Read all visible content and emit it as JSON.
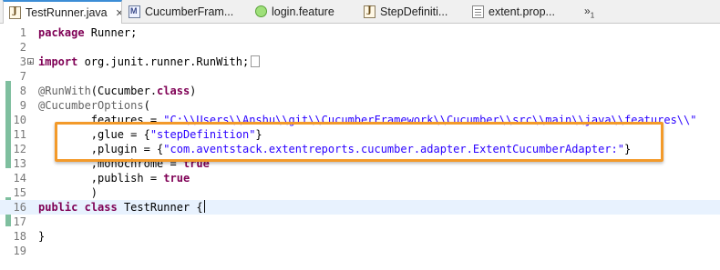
{
  "tabs": [
    {
      "label": "TestRunner.java",
      "icon": "java-file-icon",
      "active": true,
      "close": "✕"
    },
    {
      "label": "CucumberFram...",
      "icon": "java-class-icon"
    },
    {
      "label": "login.feature",
      "icon": "cucumber-feature-icon"
    },
    {
      "label": "StepDefiniti...",
      "icon": "java-file-icon"
    },
    {
      "label": "extent.prop...",
      "icon": "properties-file-icon"
    }
  ],
  "overflow": {
    "symbol": "»",
    "count": "1"
  },
  "lines": [
    {
      "num": "1",
      "parts": [
        {
          "kw": "package"
        },
        {
          "t": " Runner;"
        }
      ]
    },
    {
      "num": "2",
      "parts": []
    },
    {
      "num": "3",
      "fold": "+",
      "parts": [
        {
          "kw": "import"
        },
        {
          "t": " org.junit.runner.RunWith;"
        }
      ]
    },
    {
      "num": "7",
      "parts": []
    },
    {
      "num": "8",
      "parts": [
        {
          "ann": "@RunWith"
        },
        {
          "t": "(Cucumber."
        },
        {
          "kw": "class"
        },
        {
          "t": ")"
        }
      ]
    },
    {
      "num": "9",
      "parts": [
        {
          "ann": "@CucumberOptions"
        },
        {
          "t": "("
        }
      ]
    },
    {
      "num": "10",
      "parts": [
        {
          "t": "        features = "
        },
        {
          "str": "\"C:\\\\Users\\\\Anshu\\\\git\\\\CucumberFramework\\\\Cucumber\\\\src\\\\main\\\\java\\\\features\\\\\""
        }
      ]
    },
    {
      "num": "11",
      "parts": [
        {
          "t": "        ,glue = {"
        },
        {
          "str": "\"stepDefinition\""
        },
        {
          "t": "}"
        }
      ]
    },
    {
      "num": "12",
      "parts": [
        {
          "t": "        ,plugin = {"
        },
        {
          "str": "\"com.aventstack.extentreports.cucumber.adapter.ExtentCucumberAdapter:\""
        },
        {
          "t": "}"
        }
      ]
    },
    {
      "num": "13",
      "parts": [
        {
          "t": "        ,monochrome = "
        },
        {
          "kw": "true"
        }
      ]
    },
    {
      "num": "14",
      "parts": [
        {
          "t": "        ,publish = "
        },
        {
          "kw": "true"
        }
      ]
    },
    {
      "num": "15",
      "parts": [
        {
          "t": "        )"
        }
      ]
    },
    {
      "num": "16",
      "parts": [
        {
          "kw": "public"
        },
        {
          "t": " "
        },
        {
          "kw": "class"
        },
        {
          "t": " TestRunner {"
        }
      ],
      "current": true
    },
    {
      "num": "17",
      "parts": []
    },
    {
      "num": "18",
      "parts": [
        {
          "t": "}"
        }
      ]
    },
    {
      "num": "19",
      "parts": []
    }
  ],
  "colors": {
    "keyword": "#7f0055",
    "string": "#2a00ff",
    "annotation": "#646464",
    "highlight_box": "#f39a2a",
    "current_line": "#e8f2fe",
    "change_bar": "#7fbf9f"
  }
}
